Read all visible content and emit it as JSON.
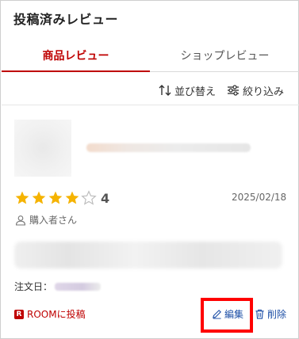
{
  "page": {
    "title": "投稿済みレビュー"
  },
  "tabs": [
    {
      "label": "商品レビュー",
      "active": true
    },
    {
      "label": "ショップレビュー",
      "active": false
    }
  ],
  "toolbar": {
    "sort_label": "並び替え",
    "filter_label": "絞り込み",
    "sort_icon": "sort-arrows-icon",
    "filter_icon": "sliders-icon"
  },
  "review": {
    "rating": "4",
    "rating_value": 4,
    "rating_max": 5,
    "date": "2025/02/18",
    "reviewer": "購入者さん",
    "order_label": "注文日：",
    "star_color": "#f5b301",
    "star_empty_color": "#bdbdbd"
  },
  "actions": {
    "room_label": "ROOMに投稿",
    "room_logo": "R",
    "edit_label": "編集",
    "delete_label": "削除",
    "highlight_color": "#ff0000"
  },
  "colors": {
    "accent": "#bf0000",
    "link": "#1d4fa6"
  }
}
